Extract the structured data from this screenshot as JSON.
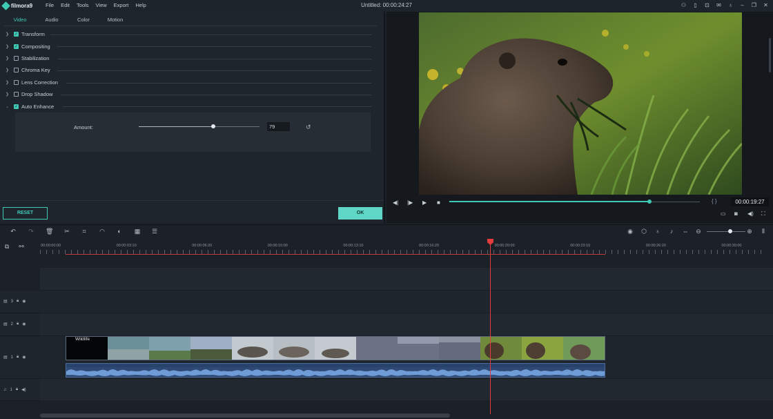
{
  "app": {
    "logo": "filmora9",
    "menu": [
      "File",
      "Edit",
      "Tools",
      "View",
      "Export",
      "Help"
    ],
    "window_title": "Untitled: 00:00:24:27",
    "title_icons": [
      "user-icon",
      "lock-icon",
      "cart-icon",
      "mail-icon",
      "mic-icon",
      "minimize-icon",
      "maximize-icon",
      "close-icon"
    ]
  },
  "editor": {
    "tabs": [
      "Video",
      "Audio",
      "Color",
      "Motion"
    ],
    "active_tab": "Video",
    "properties": [
      {
        "label": "Transform",
        "checked": true,
        "expanded": false
      },
      {
        "label": "Compositing",
        "checked": true,
        "expanded": false
      },
      {
        "label": "Stabilization",
        "checked": false,
        "expanded": false
      },
      {
        "label": "Chroma Key",
        "checked": false,
        "expanded": false
      },
      {
        "label": "Lens Correction",
        "checked": false,
        "expanded": false
      },
      {
        "label": "Drop Shadow",
        "checked": false,
        "expanded": false
      },
      {
        "label": "Auto Enhance",
        "checked": true,
        "expanded": true
      }
    ],
    "amount_label": "Amount:",
    "amount_value": "79",
    "amount_fraction": 0.79,
    "reset_label": "RESET",
    "ok_label": "OK"
  },
  "player": {
    "timecode": "00:00:19:27",
    "progress_fraction": 0.8,
    "brackets": "{ }"
  },
  "timeline": {
    "ruler_labels": [
      "00:00:00:00",
      "00:00:03:10",
      "00:00:06:20",
      "00:00:10:00",
      "00:00:13:10",
      "00:00:16:20",
      "00:00:20:00",
      "00:00:23:10",
      "00:00:26:20",
      "00:00:30:00"
    ],
    "tracks": [
      {
        "label": "3",
        "type": "video"
      },
      {
        "label": "2",
        "type": "video"
      },
      {
        "label": "1",
        "type": "video"
      },
      {
        "label": "1",
        "type": "audio"
      }
    ],
    "clip_title": "Wildlife",
    "colors": {
      "accent": "#3fc9b5",
      "playhead": "#e53b3e",
      "audio": "#2e4a74"
    }
  }
}
